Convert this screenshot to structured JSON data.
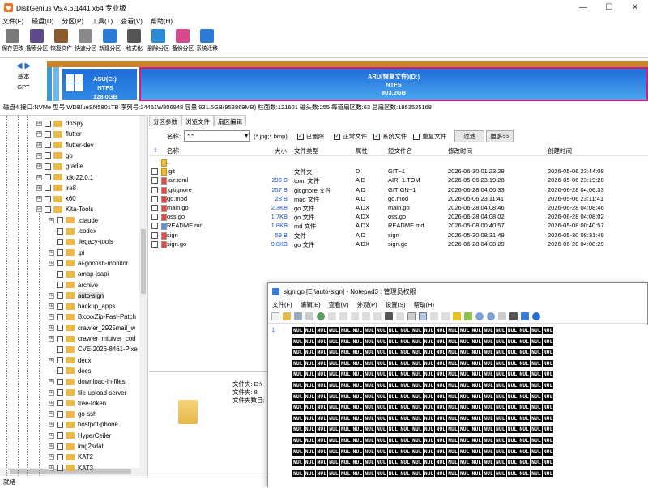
{
  "window": {
    "title": "DiskGenius V5.4.6.1441 x64 专业版",
    "minimize": "—",
    "maximize": "☐",
    "close": "✕"
  },
  "menu": [
    "文件(F)",
    "磁盘(D)",
    "分区(P)",
    "工具(T)",
    "查看(V)",
    "帮助(H)"
  ],
  "toolbar": [
    {
      "label": "保存更改",
      "color": "#7a7a7a"
    },
    {
      "label": "搜索分区",
      "color": "#5c4a8a"
    },
    {
      "label": "恢复文件",
      "color": "#8a5a2a"
    },
    {
      "label": "快速分区",
      "color": "#8a8a8a"
    },
    {
      "label": "新建分区",
      "color": "#2a7ad6"
    },
    {
      "label": "格式化",
      "color": "#555555"
    },
    {
      "label": "删除分区",
      "color": "#2a8ad6"
    },
    {
      "label": "备份分区",
      "color": "#d64a8a"
    },
    {
      "label": "系统迁移",
      "color": "#2a7ad6"
    }
  ],
  "disk": {
    "nav_label1": "基本",
    "nav_label2": "GPT",
    "partC": {
      "name": "ASU(C:)",
      "fs": "NTFS",
      "size": "128.0GB"
    },
    "partD": {
      "name": "ARU(恢复文件)(D:)",
      "fs": "NTFS",
      "size": "803.2GB"
    },
    "info": "磁盘4 接口:NVMe  型号:WDBlueSN5801TB  序列号:24461W806948  容量:931.5GB(953869MB)  柱面数:121601  磁头数:255  每道扇区数:63  总扇区数:1953525168"
  },
  "tree": [
    {
      "label": "dnSpy",
      "level": 0,
      "expander": "⊞"
    },
    {
      "label": "flutter",
      "level": 0,
      "expander": "⊞"
    },
    {
      "label": "flutter-dev",
      "level": 0,
      "expander": "⊞"
    },
    {
      "label": "go",
      "level": 0,
      "expander": "⊞"
    },
    {
      "label": "gradle",
      "level": 0,
      "expander": "⊞"
    },
    {
      "label": "jdk-22.0.1",
      "level": 0,
      "expander": "⊞"
    },
    {
      "label": "jre8",
      "level": 0,
      "expander": "⊞"
    },
    {
      "label": "k60",
      "level": 0,
      "expander": "⊞"
    },
    {
      "label": "Kita-Tools",
      "level": 0,
      "expander": "⊟"
    },
    {
      "label": ".claude",
      "level": 1,
      "expander": "⊞"
    },
    {
      "label": ".codex",
      "level": 1,
      "expander": ""
    },
    {
      "label": ".legacy-tools",
      "level": 1,
      "expander": ""
    },
    {
      "label": ".pi",
      "level": 1,
      "expander": "⊞"
    },
    {
      "label": "ai-goofish-monitor",
      "level": 1,
      "expander": "⊞"
    },
    {
      "label": "amap-jsapi",
      "level": 1,
      "expander": ""
    },
    {
      "label": "archive",
      "level": 1,
      "expander": ""
    },
    {
      "label": "auto-sign",
      "level": 1,
      "expander": "⊞",
      "selected": true
    },
    {
      "label": "backup_apps",
      "level": 1,
      "expander": "⊞"
    },
    {
      "label": "BxxxxZip-Fast-Patch",
      "level": 1,
      "expander": "⊞"
    },
    {
      "label": "crawler_2925mail_w",
      "level": 1,
      "expander": "⊞"
    },
    {
      "label": "crawler_miuiver_cod",
      "level": 1,
      "expander": "⊞"
    },
    {
      "label": "CVE-2026-8461-Pixe",
      "level": 1,
      "expander": ""
    },
    {
      "label": "decx",
      "level": 1,
      "expander": "⊞"
    },
    {
      "label": "docs",
      "level": 1,
      "expander": ""
    },
    {
      "label": "download-ln-files",
      "level": 1,
      "expander": "⊞"
    },
    {
      "label": "file-upload-server",
      "level": 1,
      "expander": "⊞"
    },
    {
      "label": "free-token",
      "level": 1,
      "expander": "⊞"
    },
    {
      "label": "go-ssh",
      "level": 1,
      "expander": "⊞"
    },
    {
      "label": "hostpot-phone",
      "level": 1,
      "expander": "⊞"
    },
    {
      "label": "HyperCeiler",
      "level": 1,
      "expander": "⊞"
    },
    {
      "label": "img2sdat",
      "level": 1,
      "expander": "⊞"
    },
    {
      "label": "KAT2",
      "level": 1,
      "expander": "⊞"
    },
    {
      "label": "KAT3",
      "level": 1,
      "expander": "⊞"
    }
  ],
  "tabs": [
    "分区参数",
    "浏览文件",
    "扇区编辑"
  ],
  "filter": {
    "name_label": "名称:",
    "name_value": "*.*",
    "hint": "(*.jpg;*.bmp)",
    "deleted": "已删除",
    "normal": "正常文件",
    "system": "系统文件",
    "duplicate": "重复文件",
    "filter_btn": "过滤",
    "more_btn": "更多>>"
  },
  "columns": {
    "name": "名称",
    "size": "大小",
    "type": "文件类型",
    "attr": "属性",
    "short": "短文件名",
    "modified": "修改时间",
    "created": "创建时间"
  },
  "files": [
    {
      "name": "..",
      "size": "",
      "type": "",
      "attr": "",
      "short": "",
      "modified": "",
      "created": "",
      "icon": "y",
      "nocb": true
    },
    {
      "name": ".git",
      "size": "",
      "type": "文件夹",
      "attr": "D",
      "short": "GIT~1",
      "modified": "2026-06-30 01:23:29",
      "created": "2026-05-06 23:44:08",
      "icon": "y"
    },
    {
      "name": ".air.toml",
      "size": "298 B",
      "type": "toml 文件",
      "attr": "A D",
      "short": "AIR~1.TOM",
      "modified": "2026-05-06 23:19:28",
      "created": "2026-05-06 23:19:28",
      "icon": "r"
    },
    {
      "name": ".gitignore",
      "size": "257 B",
      "type": "gitignore 文件",
      "attr": "A D",
      "short": "GITIGN~1",
      "modified": "2026-06-28 04:06:33",
      "created": "2026-06-28 04:06:33",
      "icon": "r"
    },
    {
      "name": "go.mod",
      "size": "28 B",
      "type": "mod 文件",
      "attr": "A D",
      "short": "go.mod",
      "modified": "2026-05-06 23:11:41",
      "created": "2026-05-06 23:11:41",
      "icon": "r"
    },
    {
      "name": "main.go",
      "size": "2.3KB",
      "type": "go 文件",
      "attr": "A DX",
      "short": "main.go",
      "modified": "2026-06-28 04:08:46",
      "created": "2026-06-28 04:08:46",
      "icon": "r"
    },
    {
      "name": "oss.go",
      "size": "1.7KB",
      "type": "go 文件",
      "attr": "A DX",
      "short": "oss.go",
      "modified": "2026-06-28 04:08:02",
      "created": "2026-06-28 04:08:02",
      "icon": "r"
    },
    {
      "name": "README.md",
      "size": "1.8KB",
      "type": "md 文件",
      "attr": "A DX",
      "short": "README.md",
      "modified": "2026-05-08 00:40:57",
      "created": "2026-05-08 00:40:57",
      "icon": "b"
    },
    {
      "name": "sign",
      "size": "59 B",
      "type": "文件",
      "attr": "A D",
      "short": "sign",
      "modified": "2026-05-30 08:31:49",
      "created": "2026-05-30 08:31:49",
      "icon": "r"
    },
    {
      "name": "sign.go",
      "size": "9.8KB",
      "type": "go 文件",
      "attr": "A DX",
      "short": "sign.go",
      "modified": "2026-06-28 04:08:29",
      "created": "2026-06-28 04:08:29",
      "icon": "r"
    }
  ],
  "preview": {
    "l1": "文件夹: D:\\",
    "l2": "文件夹: 8",
    "l3": "文件夹数目:"
  },
  "status": "就绪",
  "notepad": {
    "title": "sign.go [E:\\auto-sign] - Notepad3 : 管理员权限",
    "menu": [
      "文件(F)",
      "编辑(E)",
      "查看(V)",
      "外观(P)",
      "设置(S)",
      "帮助(H)"
    ],
    "line_no": "1",
    "nul": "NUL",
    "nul_lines": 14,
    "nul_per_line": 22
  }
}
